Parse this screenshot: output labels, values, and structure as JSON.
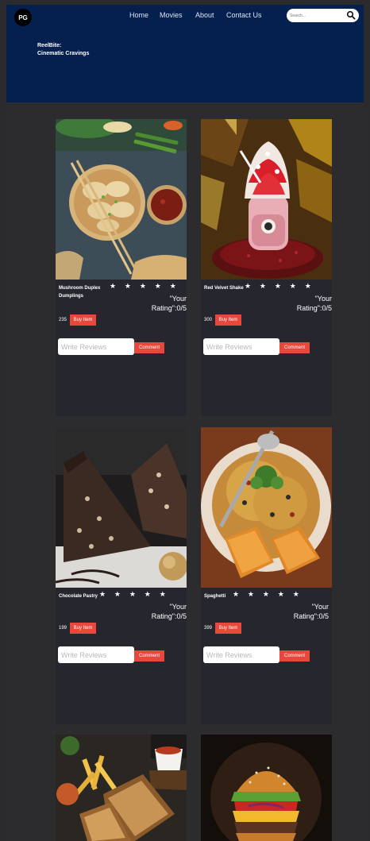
{
  "header": {
    "logo": "PG",
    "nav": [
      {
        "label": "Home"
      },
      {
        "label": "Movies"
      },
      {
        "label": "About"
      },
      {
        "label": "Contact Us"
      }
    ],
    "search_placeholder": "Search...",
    "brand_line1": "ReelBite:",
    "brand_line2": "Cinematic Cravings"
  },
  "icons": {
    "search": "search-icon",
    "star": "star-icon"
  },
  "colors": {
    "header_bg": "#04204f",
    "page_bg": "#2c2c2e",
    "card_bg": "#26262e",
    "accent": "#e8473c"
  },
  "cards": [
    {
      "name": "Mushroom Duplex Dumplings",
      "stars": "★ ★ ★ ★ ★",
      "rating_line1": "\"Your",
      "rating_line2": "Rating\":0/5",
      "price": "235",
      "buy_label": "Buy Item",
      "review_placeholder": "Write Reviews",
      "comment_label": "Comment",
      "image": "dumplings"
    },
    {
      "name": "Red Velvet Shake",
      "stars": "★ ★ ★ ★ ★",
      "rating_line1": "\"Your",
      "rating_line2": "Rating\":0/5",
      "price": "300",
      "buy_label": "Buy Item",
      "review_placeholder": "Write Reviews",
      "comment_label": "Comment",
      "image": "red-velvet-shake"
    },
    {
      "name": "Chocolate Pastry",
      "stars": "★ ★ ★ ★ ★",
      "rating_line1": "\"Your",
      "rating_line2": "Rating\":0/5",
      "price": "199",
      "buy_label": "Buy Item",
      "review_placeholder": "Write Reviews",
      "comment_label": "Comment",
      "image": "chocolate-pastry"
    },
    {
      "name": "Spaghetti",
      "stars": "★ ★ ★ ★ ★",
      "rating_line1": "\"Your Rating\":0/5",
      "rating_line2": "",
      "price": "399",
      "buy_label": "Buy Item",
      "review_placeholder": "Write Reviews",
      "comment_label": "Comment",
      "image": "spaghetti"
    },
    {
      "name": "",
      "image": "sandwich-fries"
    },
    {
      "name": "",
      "image": "burger"
    }
  ]
}
